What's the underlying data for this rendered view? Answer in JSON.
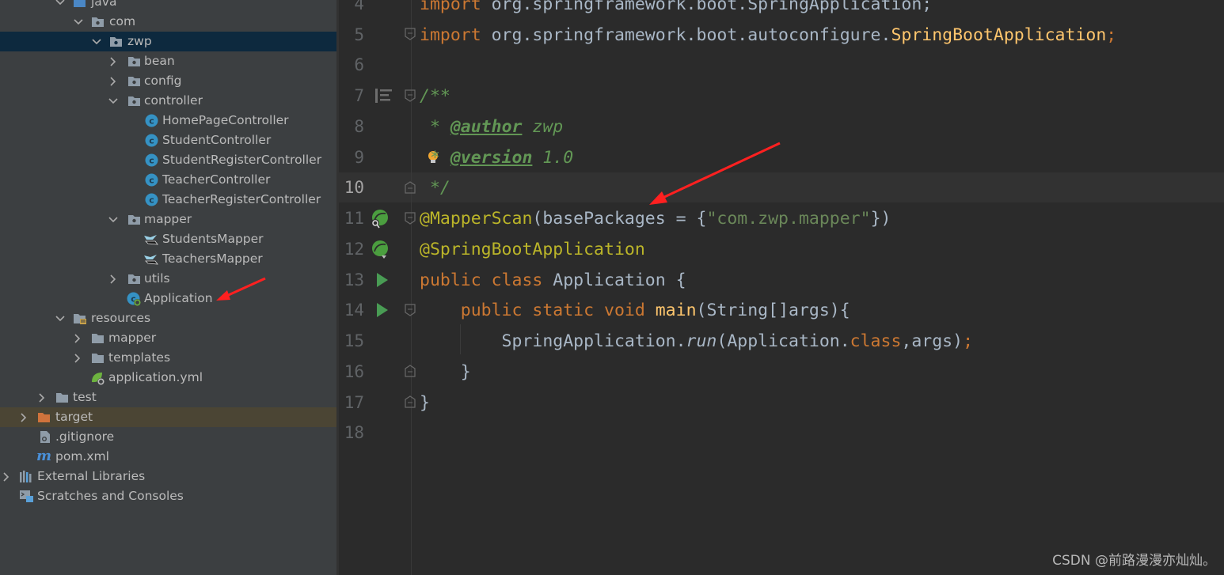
{
  "project_tree": {
    "rows": [
      {
        "label": "java",
        "kind": "folder-src"
      },
      {
        "label": "com",
        "kind": "package"
      },
      {
        "label": "zwp",
        "kind": "package"
      },
      {
        "label": "bean",
        "kind": "package"
      },
      {
        "label": "config",
        "kind": "package"
      },
      {
        "label": "controller",
        "kind": "package"
      },
      {
        "label": "HomePageController",
        "kind": "class"
      },
      {
        "label": "StudentController",
        "kind": "class"
      },
      {
        "label": "StudentRegisterController",
        "kind": "class"
      },
      {
        "label": "TeacherController",
        "kind": "class"
      },
      {
        "label": "TeacherRegisterController",
        "kind": "class"
      },
      {
        "label": "mapper",
        "kind": "package"
      },
      {
        "label": "StudentsMapper",
        "kind": "mybatis-mapper"
      },
      {
        "label": "TeachersMapper",
        "kind": "mybatis-mapper"
      },
      {
        "label": "utils",
        "kind": "package"
      },
      {
        "label": "Application",
        "kind": "spring-boot-class"
      },
      {
        "label": "resources",
        "kind": "resources-folder"
      },
      {
        "label": "mapper",
        "kind": "folder"
      },
      {
        "label": "templates",
        "kind": "folder"
      },
      {
        "label": "application.yml",
        "kind": "spring-yml"
      },
      {
        "label": "test",
        "kind": "folder"
      },
      {
        "label": "target",
        "kind": "excluded-folder"
      },
      {
        "label": ".gitignore",
        "kind": "file"
      },
      {
        "label": "pom.xml",
        "kind": "maven-file"
      },
      {
        "label": "External Libraries",
        "kind": "libraries"
      },
      {
        "label": "Scratches and Consoles",
        "kind": "scratches"
      }
    ]
  },
  "editor": {
    "line_numbers": [
      "4",
      "5",
      "6",
      "7",
      "8",
      "9",
      "10",
      "11",
      "12",
      "13",
      "14",
      "15",
      "16",
      "17",
      "18"
    ],
    "current_line": "10",
    "code": {
      "l4_kw": "import",
      "l4_rest": " org.springframework.boot.SpringApplication;",
      "l5_kw": "import",
      "l5_pkg": " org.springframework.boot.autoconfigure.",
      "l5_cls": "SpringBootApplication",
      "l5_semi": ";",
      "l7": "/**",
      "l8_star": " * ",
      "l8_tag": "@author",
      "l8_val": " zwp",
      "l9_star": " * ",
      "l9_tag": "@version",
      "l9_val": " 1.0",
      "l10": " */",
      "l11_ann": "@MapperScan",
      "l11_a": "(basePackages = {",
      "l11_str": "\"com.zwp.mapper\"",
      "l11_b": "})",
      "l12_ann": "@SpringBootApplication",
      "l13_kw": "public class",
      "l13_rest": " Application {",
      "l14_indent": "    ",
      "l14_kw": "public static void",
      "l14_sp": " ",
      "l14_fn": "main",
      "l14_rest": "(String[]args){",
      "l15_a": "        SpringApplication.",
      "l15_it": "run",
      "l15_b": "(Application.",
      "l15_kw": "class",
      "l15_c": ",args)",
      "l15_semi": ";",
      "l16": "    }",
      "l17": "}"
    }
  },
  "watermark": "CSDN @前路漫漫亦灿灿。",
  "colors": {
    "tree_bg": "#3c3f41",
    "editor_bg": "#2b2b2b",
    "keyword": "#cc7832",
    "annotation": "#bbb529",
    "string": "#6a8759",
    "doc_comment": "#629755",
    "annotation_arrow": "#ff2020"
  }
}
